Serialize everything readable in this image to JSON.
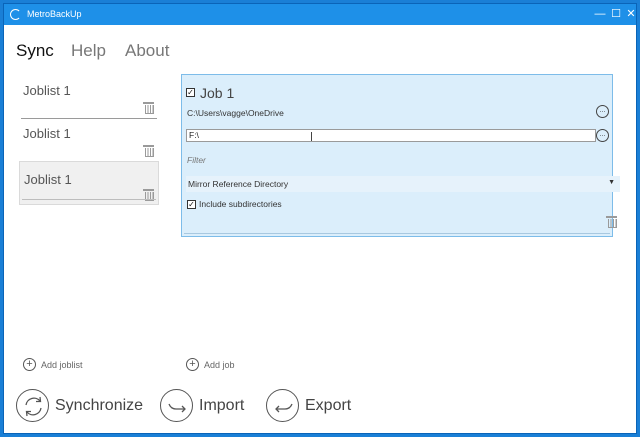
{
  "window": {
    "title": "MetroBackUp",
    "controls": {
      "minimize": "—",
      "maximize": "☐",
      "close": "✕"
    }
  },
  "nav": {
    "tabs": [
      "Sync",
      "Help",
      "About"
    ],
    "active": "Sync"
  },
  "joblists": [
    {
      "name": "Joblist 1",
      "selected": false
    },
    {
      "name": "Joblist 1",
      "selected": false
    },
    {
      "name": "Joblist 1",
      "selected": true
    }
  ],
  "job": {
    "title": "Job 1",
    "enabled": true,
    "source_path": "C:\\Users\\vagge\\OneDrive",
    "destination_path": "F:\\",
    "filter_placeholder": "Filter",
    "mode": "Mirror Reference Directory",
    "include_subdirectories_label": "Include subdirectories",
    "include_subdirectories": true,
    "ellipsis": "..."
  },
  "add_joblist_label": "Add joblist",
  "add_job_label": "Add job",
  "actions": {
    "synchronize": "Synchronize",
    "import": "Import",
    "export": "Export"
  },
  "colors": {
    "titlebar": "#1e90e8",
    "panel": "#dbeefb",
    "panel_border": "#7dbce9"
  }
}
